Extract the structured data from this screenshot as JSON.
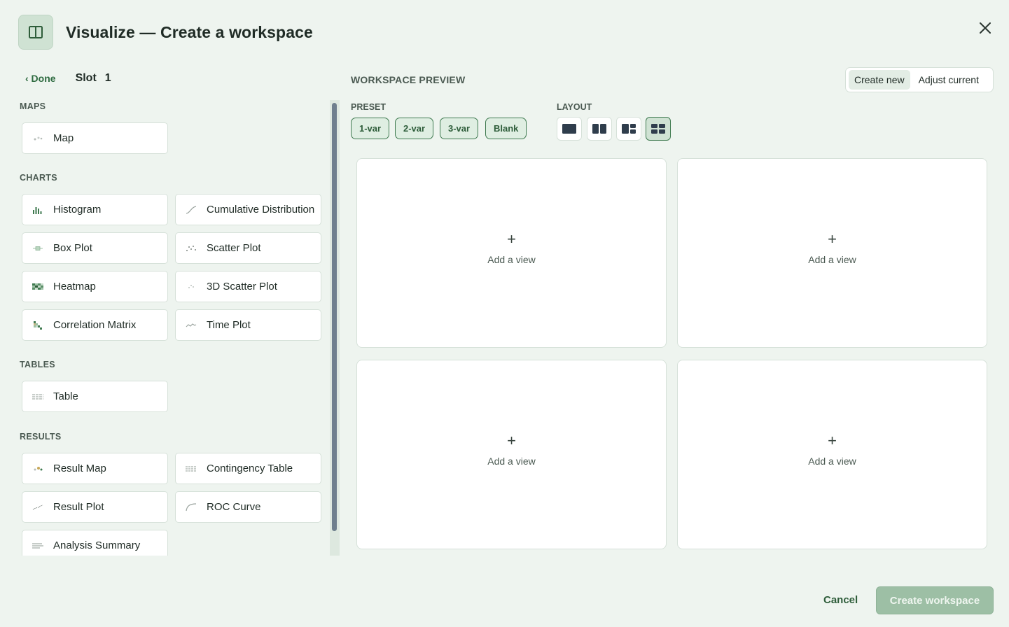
{
  "dialog": {
    "title": "Visualize — Create a workspace"
  },
  "slot": {
    "done_label": "‹ Done",
    "label": "Slot",
    "number": "1"
  },
  "sections": {
    "maps": "MAPS",
    "charts": "CHARTS",
    "tables": "TABLES",
    "results": "RESULTS"
  },
  "views": {
    "map": "Map",
    "histogram": "Histogram",
    "cumulative_distribution": "Cumulative Distribution",
    "box_plot": "Box Plot",
    "scatter_plot": "Scatter Plot",
    "heatmap": "Heatmap",
    "scatter_3d": "3D Scatter Plot",
    "correlation_matrix": "Correlation Matrix",
    "time_plot": "Time Plot",
    "table": "Table",
    "result_map": "Result Map",
    "contingency_table": "Contingency Table",
    "result_plot": "Result Plot",
    "roc_curve": "ROC Curve",
    "analysis_summary": "Analysis Summary"
  },
  "workspace": {
    "title": "WORKSPACE PREVIEW",
    "mode": {
      "create_new": "Create new",
      "adjust_current": "Adjust current",
      "selected": "create_new"
    },
    "preset_title": "PRESET",
    "presets": [
      "1-var",
      "2-var",
      "3-var",
      "Blank"
    ],
    "layout_title": "LAYOUT",
    "layouts": [
      "single",
      "two-columns",
      "one-plus-two",
      "grid-2x2"
    ],
    "selected_layout": "grid-2x2",
    "slots": [
      {
        "plus": "+",
        "label": "Add a view"
      },
      {
        "plus": "+",
        "label": "Add a view"
      },
      {
        "plus": "+",
        "label": "Add a view"
      },
      {
        "plus": "+",
        "label": "Add a view"
      }
    ]
  },
  "footer": {
    "cancel": "Cancel",
    "create": "Create workspace"
  },
  "colors": {
    "background": "#eef4ef",
    "accent": "#2e6b40",
    "primary_disabled": "#9dbfa5"
  }
}
